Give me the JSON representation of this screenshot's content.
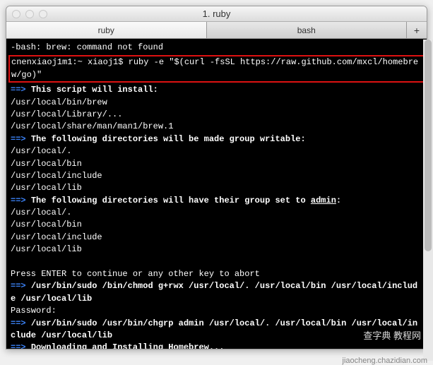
{
  "window": {
    "title": "1. ruby"
  },
  "tabs": [
    {
      "label": "ruby",
      "active": true
    },
    {
      "label": "bash",
      "active": false
    }
  ],
  "plus_label": "+",
  "terminal": {
    "line_error": "-bash: brew: command not found",
    "prompt_line": "cnenxiaoj1m1:~ xiaoj1$ ruby -e \"$(curl -fsSL https://raw.github.com/mxcl/homebrew/go)\"",
    "arrow": "==>",
    "script_install_label": "This script will install:",
    "install_paths": [
      "/usr/local/bin/brew",
      "/usr/local/Library/...",
      "/usr/local/share/man/man1/brew.1"
    ],
    "group_writable_label": "The following directories will be made group writable:",
    "writable_paths": [
      "/usr/local/.",
      "/usr/local/bin",
      "/usr/local/include",
      "/usr/local/lib"
    ],
    "group_set_prefix": "The following directories will have their group set to ",
    "group_set_value": "admin",
    "group_set_suffix": ":",
    "set_paths": [
      "/usr/local/.",
      "/usr/local/bin",
      "/usr/local/include",
      "/usr/local/lib"
    ],
    "press_enter": "Press ENTER to continue or any other key to abort",
    "sudo1": "/usr/bin/sudo /bin/chmod g+rwx /usr/local/. /usr/local/bin /usr/local/include /usr/local/lib",
    "password_label": "Password:",
    "sudo2": "/usr/bin/sudo /usr/bin/chgrp admin /usr/local/. /usr/local/bin /usr/local/include /usr/local/lib",
    "downloading_label": "Downloading and Installing Homebrew..."
  },
  "watermark": "查字典 教程网",
  "watermark_sub": "jiaocheng.chazidian.com"
}
